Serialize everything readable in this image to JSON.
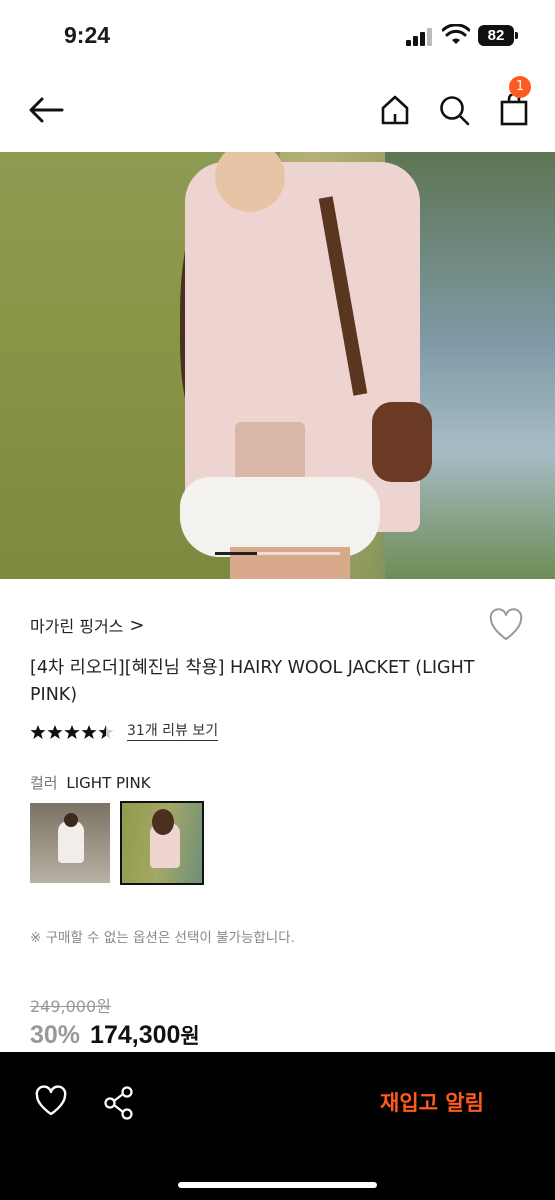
{
  "status_bar": {
    "time": "9:24",
    "battery": "82"
  },
  "header": {
    "back_icon": "arrow-left-icon",
    "home_icon": "home-icon",
    "search_icon": "search-icon",
    "bag_icon": "shopping-bag-icon",
    "cart_count": "1"
  },
  "hero": {
    "image_count": 3,
    "active_index": 1
  },
  "product": {
    "brand": "마가린 핑거스",
    "brand_chevron": ">",
    "title": "[4차 리오더][혜진님 착용] HAIRY WOOL JACKET (LIGHT PINK)",
    "rating": 4.5,
    "review_link": "31개 리뷰 보기",
    "color_label": "컬러",
    "color_value": "LIGHT PINK",
    "color_options": 2,
    "selected_color_index": 1,
    "notice": "※ 구매할 수 없는 옵션은 선택이 불가능합니다.",
    "original_price": "249,000원",
    "discount": "30%",
    "price": "174,300",
    "price_unit": "원"
  },
  "bottom_bar": {
    "wishlist_icon": "heart-icon",
    "share_icon": "share-icon",
    "restock_label": "재입고 알림"
  },
  "colors": {
    "accent": "#ff5a1f",
    "bottom_bar": "#000000",
    "muted": "#999999"
  }
}
